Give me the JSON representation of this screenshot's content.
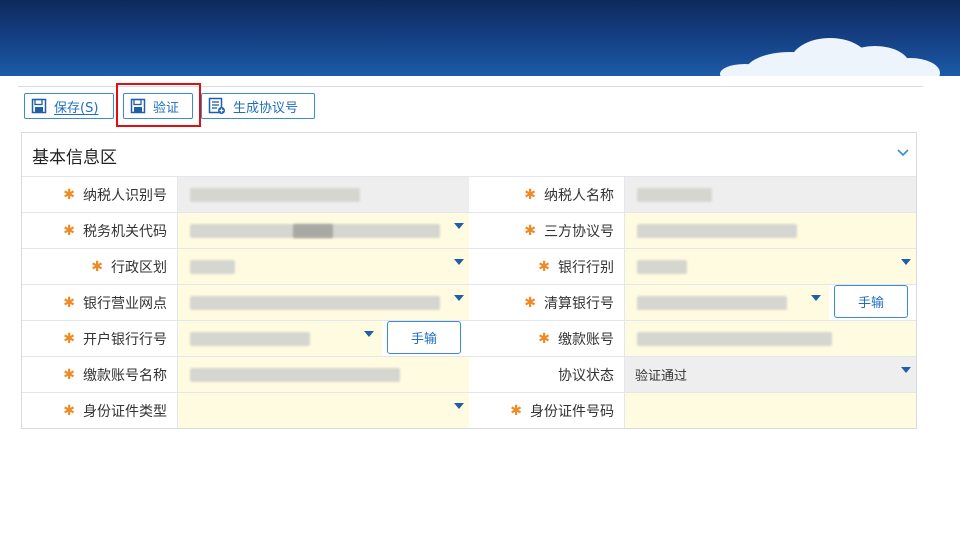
{
  "toolbar": {
    "save_label": "保存(S)",
    "verify_label": "验证",
    "generate_label": "生成协议号"
  },
  "panel": {
    "title": "基本信息区"
  },
  "fields": {
    "taxpayer_id": {
      "label": "纳税人识别号",
      "required": "✱"
    },
    "taxpayer_name": {
      "label": "纳税人名称",
      "required": "✱"
    },
    "tax_office_code": {
      "label": "税务机关代码",
      "required": "✱"
    },
    "tripartite_no": {
      "label": "三方协议号",
      "required": "✱"
    },
    "admin_region": {
      "label": "行政区划",
      "required": "✱"
    },
    "bank_type": {
      "label": "银行行别",
      "required": "✱"
    },
    "bank_branch": {
      "label": "银行营业网点",
      "required": "✱"
    },
    "clearing_bank_no": {
      "label": "清算银行号",
      "required": "✱",
      "button": "手输"
    },
    "opening_bank_no": {
      "label": "开户银行行号",
      "required": "✱",
      "button": "手输"
    },
    "payment_account": {
      "label": "缴款账号",
      "required": "✱"
    },
    "payment_account_name": {
      "label": "缴款账号名称",
      "required": "✱"
    },
    "agreement_status": {
      "label": "协议状态",
      "value": "验证通过"
    },
    "id_type": {
      "label": "身份证件类型",
      "required": "✱"
    },
    "id_number": {
      "label": "身份证件号码",
      "required": "✱"
    }
  },
  "colors": {
    "accent": "#1f6fc0",
    "required": "#f08a24",
    "highlight": "#e01010",
    "field_bg": "#fffbe0"
  }
}
